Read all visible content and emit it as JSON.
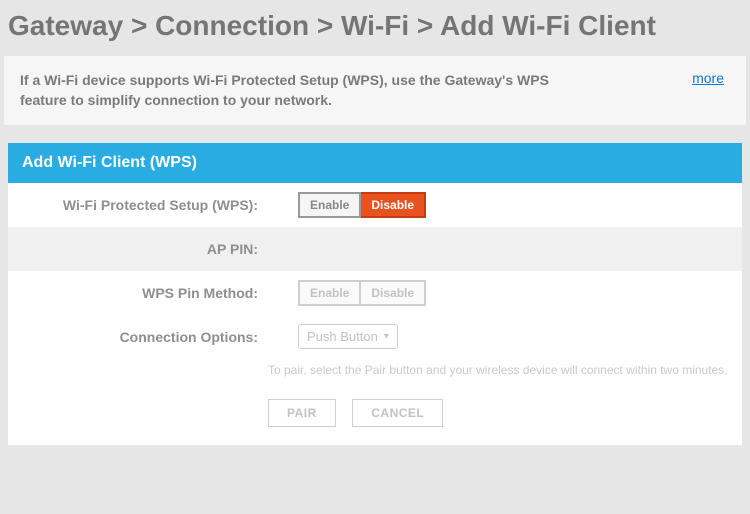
{
  "breadcrumb": {
    "text": "Gateway > Connection > Wi-Fi > Add Wi-Fi Client"
  },
  "info": {
    "text": "If a Wi-Fi device supports Wi-Fi Protected Setup (WPS), use the Gateway's WPS feature to simplify connection to your network.",
    "more_label": "more"
  },
  "panel": {
    "title": "Add Wi-Fi Client (WPS)",
    "rows": {
      "wps": {
        "label": "Wi-Fi Protected Setup (WPS):",
        "enable": "Enable",
        "disable": "Disable"
      },
      "ap_pin": {
        "label": "AP PIN:"
      },
      "pin_method": {
        "label": "WPS Pin Method:",
        "enable": "Enable",
        "disable": "Disable"
      },
      "conn_opt": {
        "label": "Connection Options:",
        "selected": "Push Button"
      }
    },
    "hint": "To pair, select the Pair button and your wireless device will connect within two minutes.",
    "actions": {
      "pair": "PAIR",
      "cancel": "CANCEL"
    }
  }
}
